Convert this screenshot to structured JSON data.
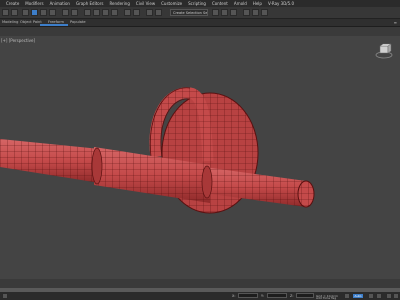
{
  "menubar": {
    "items": [
      "Create",
      "Modifiers",
      "Animation",
      "Graph Editors",
      "Rendering",
      "Civil View",
      "Customize",
      "Scripting",
      "Content",
      "Arnold",
      "Help",
      "V-Ray 3D/5.0"
    ]
  },
  "toolbar": {
    "selection_set_placeholder": "Create Selection Se"
  },
  "ribbon": {
    "tabs": [
      "Modeling",
      "Object Paint",
      "Freeform",
      "Populate"
    ],
    "menu_glyph": "≡"
  },
  "viewport": {
    "label": "[+] [Perspective]",
    "model_color": "#c44a4a",
    "wire_color": "#5a1010"
  },
  "status_bar": {
    "x_label": "X:",
    "y_label": "Y:",
    "z_label": "Z:",
    "grid": "Grid = 10,0cm",
    "add_time_tag": "Add Time Tag",
    "auto_key_label": "Auto"
  },
  "colors": {
    "accent": "#3d7ec9",
    "background": "#444444"
  }
}
